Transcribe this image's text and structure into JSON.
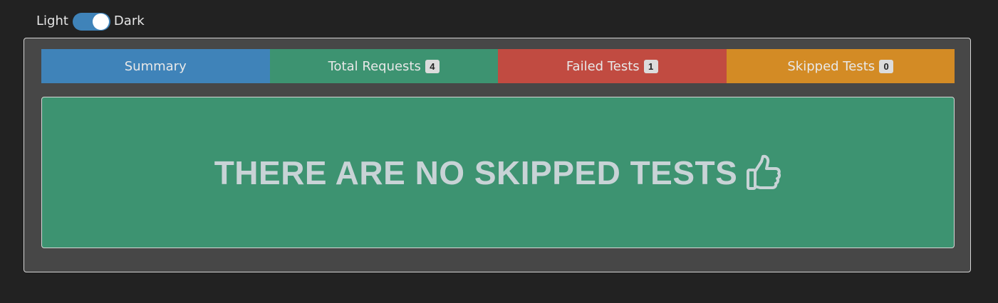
{
  "theme_toggle": {
    "light_label": "Light",
    "dark_label": "Dark",
    "state": "dark"
  },
  "tabs": [
    {
      "label": "Summary",
      "badge": null,
      "color": "#3f83b9"
    },
    {
      "label": "Total Requests",
      "badge": "4",
      "color": "#3d9371"
    },
    {
      "label": "Failed Tests",
      "badge": "1",
      "color": "#c14b41"
    },
    {
      "label": "Skipped Tests",
      "badge": "0",
      "color": "#d38b25"
    }
  ],
  "notice": {
    "text": "THERE ARE NO SKIPPED TESTS",
    "icon": "thumbs-up-icon",
    "color": "#3d9371"
  }
}
